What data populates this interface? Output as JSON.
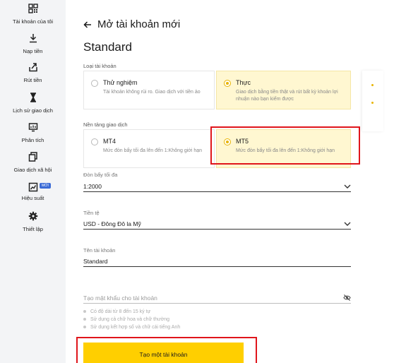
{
  "sidebar": {
    "items": [
      {
        "label": "Tài khoản của tôi",
        "icon": "grid-qr-icon"
      },
      {
        "label": "Nạp tiền",
        "icon": "download-icon"
      },
      {
        "label": "Rút tiền",
        "icon": "withdraw-icon"
      },
      {
        "label": "Lịch sử giao dịch",
        "icon": "hourglass-icon"
      },
      {
        "label": "Phân tích",
        "icon": "analytics-icon"
      },
      {
        "label": "Giao dịch xã hội",
        "icon": "copy-trading-icon"
      },
      {
        "label": "Hiệu suất",
        "icon": "performance-icon",
        "badge": "MỚI"
      },
      {
        "label": "Thiết lập",
        "icon": "gear-icon"
      }
    ]
  },
  "header": {
    "title": "Mở tài khoản mới",
    "account_type": "Standard"
  },
  "account_kind": {
    "label": "Loại tài khoản",
    "options": [
      {
        "title": "Thử nghiệm",
        "desc": "Tài khoản không rủi ro. Giao dịch với tiền ảo",
        "selected": false
      },
      {
        "title": "Thực",
        "desc": "Giao dịch bằng tiền thật và rút bất kỳ khoản lợi nhuận nào bạn kiếm được",
        "selected": true
      }
    ]
  },
  "platform": {
    "label": "Nền tảng giao dịch",
    "options": [
      {
        "title": "MT4",
        "desc": "Mức đòn bẩy tối đa lên đến 1:Không giới hạn",
        "selected": false
      },
      {
        "title": "MT5",
        "desc": "Mức đòn bẩy tối đa lên đến 1:Không giới hạn",
        "selected": true
      }
    ]
  },
  "leverage": {
    "label": "Đòn bẩy tối đa",
    "value": "1:2000"
  },
  "currency": {
    "label": "Tiền tệ",
    "value": "USD - Đông Đô la Mỹ"
  },
  "account_name": {
    "label": "Tên tài khoản",
    "value": "Standard"
  },
  "password": {
    "placeholder": "Tạo mật khẩu cho tài khoản",
    "hints": [
      "Có độ dài từ 8 đến 15 ký tự",
      "Sử dụng cả chữ hoa và chữ thường",
      "Sử dụng kết hợp số và chữ cái tiếng Anh"
    ]
  },
  "submit": {
    "label": "Tạo một tài khoản"
  },
  "colors": {
    "accent": "#ffcf00",
    "selected_bg": "#fff7d1",
    "highlight": "#e0151b",
    "sidebar_bg": "#f3f4f6"
  }
}
